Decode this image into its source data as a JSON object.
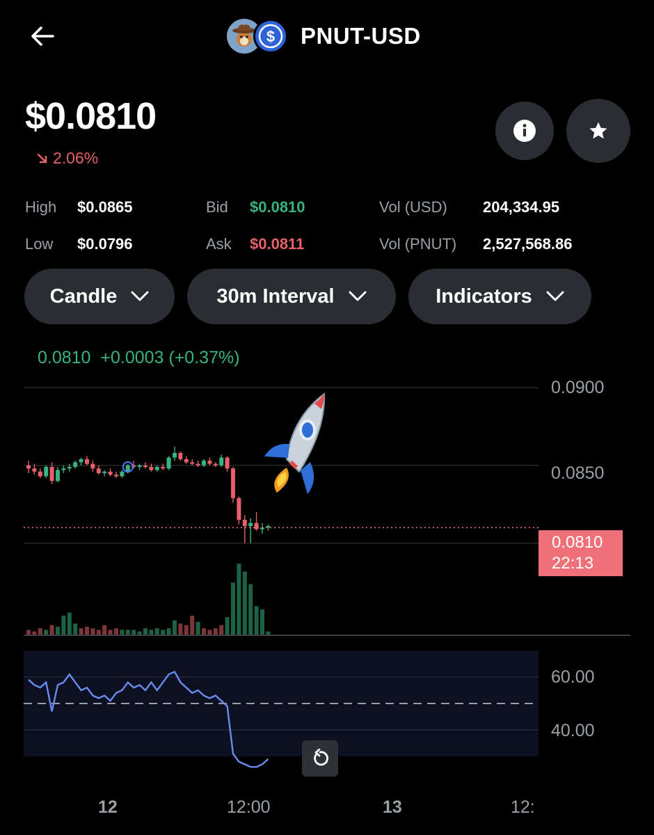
{
  "header": {
    "back_icon": "arrow-left-icon",
    "base_coin_icon": "pnut-coin-icon",
    "quote_coin_icon": "usd-coin-icon",
    "title": "PNUT-USD"
  },
  "price": {
    "value": "$0.0810",
    "change": "2.06%",
    "change_direction_icon": "arrow-down-right-icon",
    "info_icon": "info-icon",
    "favorite_icon": "star-icon"
  },
  "stats": {
    "high_label": "High",
    "high_value": "$0.0865",
    "low_label": "Low",
    "low_value": "$0.0796",
    "bid_label": "Bid",
    "bid_value": "$0.0810",
    "ask_label": "Ask",
    "ask_value": "$0.0811",
    "vol_usd_label": "Vol (USD)",
    "vol_usd_value": "204,334.95",
    "vol_pnut_label": "Vol (PNUT)",
    "vol_pnut_value": "2,527,568.86"
  },
  "controls": {
    "chart_type": "Candle",
    "interval": "30m Interval",
    "indicators": "Indicators"
  },
  "legend": {
    "last": "0.0810",
    "change": "+0.0003 (+0.37%)"
  },
  "colors": {
    "up": "#36b37e",
    "down": "#e5606a",
    "rsi": "#6a8cf0",
    "price_tag": "#f0707a"
  },
  "chart_data": {
    "type": "candlestick",
    "price_axis_ticks": [
      "0.0900",
      "0.0850"
    ],
    "price_range": [
      0.079,
      0.09
    ],
    "current_price_label": "0.0810",
    "countdown_label": "22:13",
    "rsi_axis_ticks": [
      "60.00",
      "40.00"
    ],
    "rsi_range": [
      30,
      70
    ],
    "x_ticks": [
      "12",
      "12:00",
      "13",
      "12:"
    ],
    "candles": [
      [
        0.085,
        0.0853,
        0.0845,
        0.0848
      ],
      [
        0.0848,
        0.0851,
        0.0844,
        0.0846
      ],
      [
        0.0846,
        0.0848,
        0.0842,
        0.0843
      ],
      [
        0.0843,
        0.085,
        0.0842,
        0.0849
      ],
      [
        0.0849,
        0.0852,
        0.0838,
        0.084
      ],
      [
        0.084,
        0.0849,
        0.0839,
        0.0847
      ],
      [
        0.0847,
        0.085,
        0.0845,
        0.0848
      ],
      [
        0.0848,
        0.0851,
        0.0846,
        0.0849
      ],
      [
        0.0849,
        0.0853,
        0.0848,
        0.0852
      ],
      [
        0.0852,
        0.0855,
        0.085,
        0.0854
      ],
      [
        0.0854,
        0.0856,
        0.085,
        0.0851
      ],
      [
        0.0851,
        0.0853,
        0.0846,
        0.0848
      ],
      [
        0.0848,
        0.085,
        0.0844,
        0.0845
      ],
      [
        0.0845,
        0.0847,
        0.0843,
        0.0846
      ],
      [
        0.0846,
        0.0848,
        0.0843,
        0.0844
      ],
      [
        0.0844,
        0.0846,
        0.0842,
        0.0843
      ],
      [
        0.0843,
        0.0847,
        0.0842,
        0.0846
      ],
      [
        0.0846,
        0.0851,
        0.0845,
        0.085
      ],
      [
        0.085,
        0.0853,
        0.0848,
        0.0849
      ],
      [
        0.0849,
        0.0851,
        0.0847,
        0.085
      ],
      [
        0.085,
        0.0852,
        0.0848,
        0.0849
      ],
      [
        0.0849,
        0.0851,
        0.0846,
        0.0847
      ],
      [
        0.0847,
        0.085,
        0.0846,
        0.0849
      ],
      [
        0.0849,
        0.0851,
        0.0847,
        0.0848
      ],
      [
        0.0848,
        0.0856,
        0.0847,
        0.0855
      ],
      [
        0.0855,
        0.0862,
        0.0853,
        0.0858
      ],
      [
        0.0858,
        0.0859,
        0.0853,
        0.0854
      ],
      [
        0.0854,
        0.0856,
        0.0851,
        0.0852
      ],
      [
        0.0852,
        0.0854,
        0.085,
        0.0851
      ],
      [
        0.0851,
        0.0853,
        0.0849,
        0.085
      ],
      [
        0.085,
        0.0854,
        0.0849,
        0.0853
      ],
      [
        0.0853,
        0.0855,
        0.085,
        0.0851
      ],
      [
        0.0851,
        0.0852,
        0.0849,
        0.085
      ],
      [
        0.085,
        0.0857,
        0.0849,
        0.0855
      ],
      [
        0.0855,
        0.0856,
        0.0846,
        0.0848
      ],
      [
        0.0848,
        0.0849,
        0.0826,
        0.0829
      ],
      [
        0.0829,
        0.083,
        0.0812,
        0.0815
      ],
      [
        0.0815,
        0.0818,
        0.08,
        0.0811
      ],
      [
        0.0811,
        0.0816,
        0.08,
        0.0813
      ],
      [
        0.0813,
        0.082,
        0.0808,
        0.0809
      ],
      [
        0.0809,
        0.0813,
        0.0806,
        0.081
      ],
      [
        0.081,
        0.0812,
        0.0808,
        0.0811
      ]
    ],
    "volumes": [
      [
        3,
        0
      ],
      [
        2,
        0
      ],
      [
        4,
        0
      ],
      [
        3,
        1
      ],
      [
        6,
        0
      ],
      [
        5,
        1
      ],
      [
        12,
        1
      ],
      [
        14,
        1
      ],
      [
        7,
        1
      ],
      [
        4,
        0
      ],
      [
        5,
        0
      ],
      [
        4,
        0
      ],
      [
        3,
        0
      ],
      [
        6,
        0
      ],
      [
        3,
        0
      ],
      [
        4,
        0
      ],
      [
        3,
        1
      ],
      [
        3,
        1
      ],
      [
        3,
        1
      ],
      [
        2,
        1
      ],
      [
        4,
        1
      ],
      [
        3,
        1
      ],
      [
        4,
        1
      ],
      [
        3,
        1
      ],
      [
        4,
        1
      ],
      [
        9,
        1
      ],
      [
        7,
        0
      ],
      [
        6,
        0
      ],
      [
        12,
        0
      ],
      [
        8,
        1
      ],
      [
        4,
        0
      ],
      [
        3,
        0
      ],
      [
        4,
        0
      ],
      [
        6,
        0
      ],
      [
        11,
        1
      ],
      [
        33,
        1
      ],
      [
        45,
        1
      ],
      [
        40,
        1
      ],
      [
        32,
        1
      ],
      [
        18,
        1
      ],
      [
        16,
        1
      ],
      [
        2,
        1
      ]
    ],
    "rsi": [
      59,
      57,
      56,
      58,
      47,
      57,
      58,
      61,
      58,
      55,
      56,
      53,
      52,
      53,
      51,
      54,
      55,
      58,
      56,
      57,
      55,
      58,
      55,
      58,
      61,
      62,
      58,
      56,
      54,
      55,
      53,
      52,
      53,
      51,
      49,
      31,
      28,
      27,
      26,
      26,
      27,
      29
    ]
  },
  "reset_icon": "reset-zoom-icon",
  "rocket_icon": "rocket-emoji-icon"
}
